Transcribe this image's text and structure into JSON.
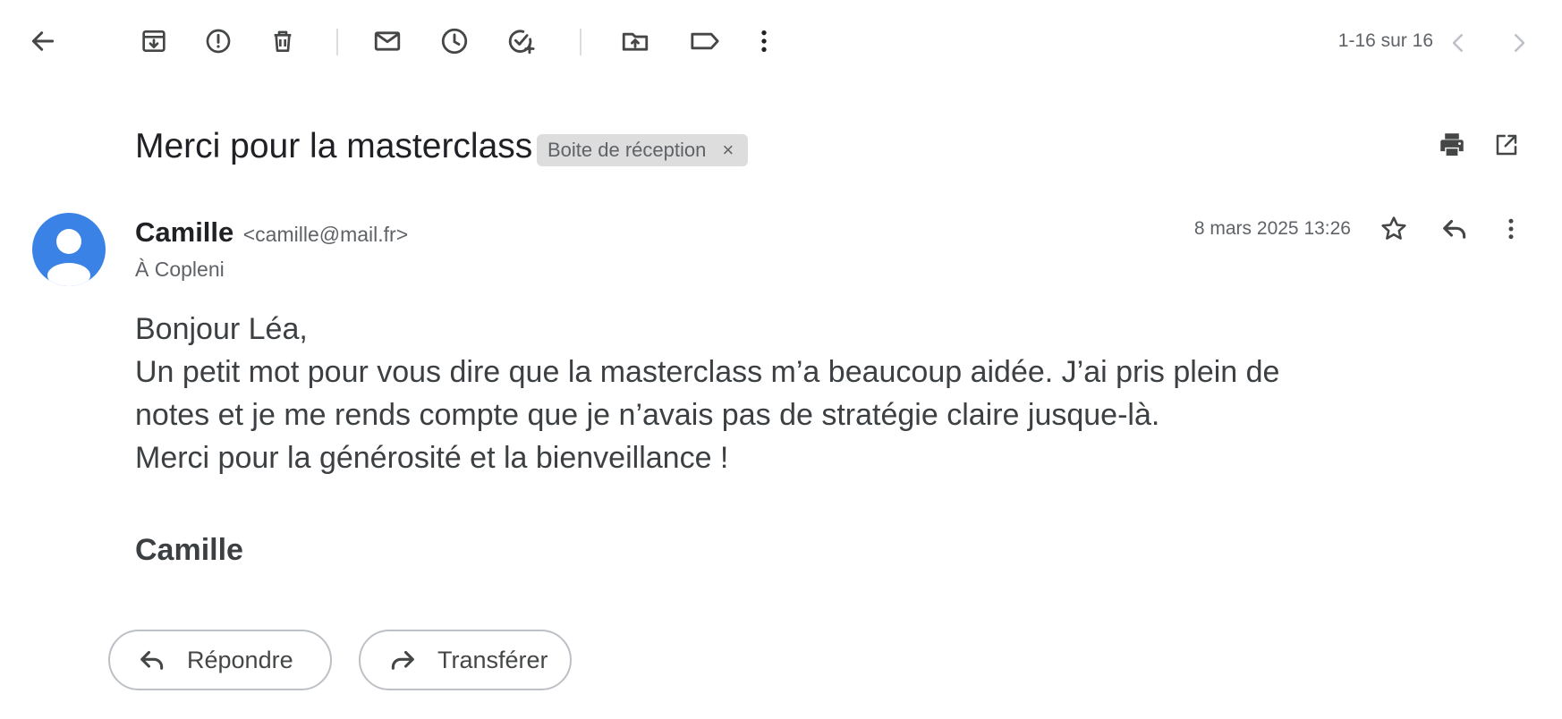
{
  "toolbar": {
    "back_icon": "arrow-left-icon",
    "actions": [
      {
        "name": "archive",
        "icon": "archive-icon"
      },
      {
        "name": "report-spam",
        "icon": "alert-circle-icon"
      },
      {
        "name": "delete",
        "icon": "trash-icon"
      },
      {
        "name": "mark-unread",
        "icon": "mail-icon"
      },
      {
        "name": "snooze",
        "icon": "clock-icon"
      },
      {
        "name": "add-task",
        "icon": "task-add-icon"
      },
      {
        "name": "move-to",
        "icon": "folder-move-icon"
      },
      {
        "name": "labels",
        "icon": "label-icon"
      },
      {
        "name": "more",
        "icon": "more-vertical-icon"
      }
    ],
    "pager": "1-16 sur 16"
  },
  "message": {
    "subject": "Merci pour la masterclass",
    "label": "Boite de réception",
    "label_close": "×",
    "sender_name": "Camille",
    "sender_email": "<camille@mail.fr>",
    "recipient": "À Copleni",
    "datetime": "8 mars 2025 13:26",
    "avatar_color": "#3b82e6",
    "body": [
      "Bonjour Léa,",
      "Un petit mot pour vous dire que la masterclass m’a beaucoup aidée. J’ai pris plein de notes et je me rends compte que je n’avais pas de stratégie claire jusque-là.",
      "Merci pour la générosité et la bienveillance !"
    ],
    "signature": "Camille"
  },
  "footer": {
    "reply_label": "Répondre",
    "forward_label": "Transférer"
  },
  "colors": {
    "text_primary": "#202124",
    "text_secondary": "#5f6368",
    "icon": "#444746",
    "chip_bg": "#dddddd",
    "accent": "#3b82e6"
  }
}
